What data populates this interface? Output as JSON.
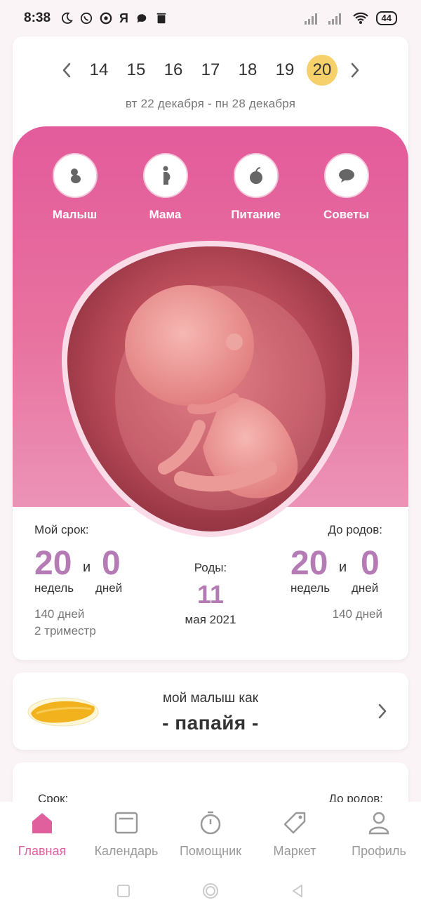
{
  "status_bar": {
    "time": "8:38",
    "battery": "44",
    "icons": [
      "moon-icon",
      "whatsapp-icon",
      "chrome-icon",
      "yandex-icon",
      "chat-icon",
      "trash-icon"
    ],
    "yandex_letter": "Я"
  },
  "week_selector": {
    "weeks": [
      "14",
      "15",
      "16",
      "17",
      "18",
      "19",
      "20"
    ],
    "selected": "20",
    "date_range": "вт 22 декабря - пн 28 декабря"
  },
  "sections": [
    {
      "label": "Малыш",
      "icon": "baby-icon"
    },
    {
      "label": "Мама",
      "icon": "pregnant-icon"
    },
    {
      "label": "Питание",
      "icon": "apple-icon"
    },
    {
      "label": "Советы",
      "icon": "speech-bubble-icon"
    }
  ],
  "colors": {
    "accent_pink": "#e35b9b",
    "number_purple": "#b57bb5",
    "selected_week": "#f6d06a",
    "active_tab": "#e0609e"
  },
  "term": {
    "label": "Мой срок:",
    "weeks": "20",
    "and": "и",
    "days": "0",
    "weeks_unit": "недель",
    "days_unit": "дней",
    "total_days": "140 дней",
    "trimester": "2 триместр"
  },
  "birth": {
    "label": "Роды:",
    "day": "11",
    "month_year": "мая 2021"
  },
  "until_birth": {
    "label": "До родов:",
    "weeks": "20",
    "and": "и",
    "days": "0",
    "weeks_unit": "недель",
    "days_unit": "дней",
    "total_days": "140 дней"
  },
  "baby_card": {
    "line1": "мой малыш как",
    "line2": "- папайя -"
  },
  "third_card": {
    "left": "Срок:",
    "right": "До родов:"
  },
  "bottom_nav": [
    {
      "label": "Главная",
      "icon": "home-icon",
      "active": true
    },
    {
      "label": "Календарь",
      "icon": "calendar-icon",
      "active": false
    },
    {
      "label": "Помощник",
      "icon": "timer-icon",
      "active": false
    },
    {
      "label": "Маркет",
      "icon": "tag-icon",
      "active": false
    },
    {
      "label": "Профиль",
      "icon": "profile-icon",
      "active": false
    }
  ]
}
